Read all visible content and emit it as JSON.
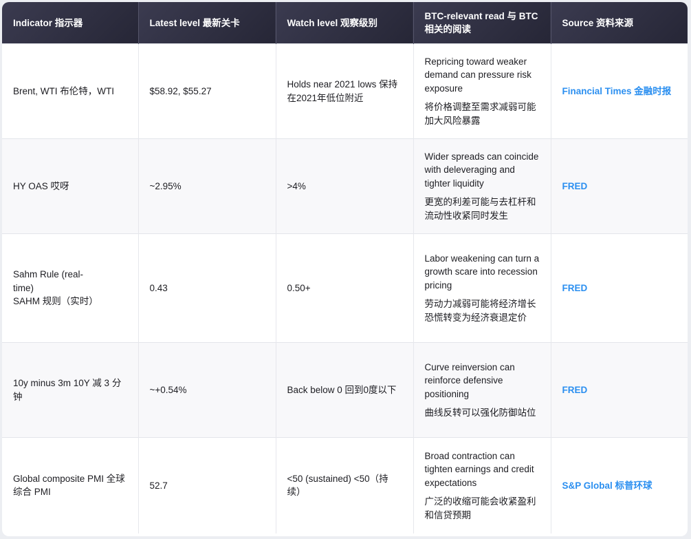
{
  "headers": [
    "Indicator  指示器",
    "Latest level  最新关卡",
    "Watch level  观察级别",
    "BTC-relevant read  与 BTC 相关的阅读",
    "Source  资料来源"
  ],
  "rows": [
    {
      "indicator": "Brent, WTI  布伦特，WTI",
      "latest": "$58.92, $55.27",
      "watch": "Holds near 2021 lows  保持在2021年低位附近",
      "read_en": "Repricing toward weaker demand can pressure risk exposure",
      "read_zh": "将价格调整至需求减弱可能加大风险暴露",
      "source": "Financial Times  金融时报"
    },
    {
      "indicator": "HY OAS  哎呀",
      "latest": "~2.95%",
      "watch": ">4%",
      "read_en": "Wider spreads can coincide with deleveraging and tighter liquidity",
      "read_zh": "更宽的利差可能与去杠杆和流动性收紧同时发生",
      "source": "FRED"
    },
    {
      "indicator": "Sahm Rule (real-time)",
      "indicator_zh": "SAHM 规则（实时）",
      "latest": "0.43",
      "watch": "0.50+",
      "read_en": "Labor weakening can turn a growth scare into recession pricing",
      "read_zh": "劳动力减弱可能将经济增长恐慌转变为经济衰退定价",
      "source": "FRED"
    },
    {
      "indicator": "10y minus 3m  10Y 减 3 分钟",
      "latest": "~+0.54%",
      "watch": "Back below 0  回到0度以下",
      "read_en": "Curve reinversion can reinforce defensive positioning",
      "read_zh": "曲线反转可以强化防御站位",
      "source": "FRED"
    },
    {
      "indicator": "Global composite PMI  全球综合 PMI",
      "latest": "52.7",
      "watch": "<50 (sustained)  <50（持续）",
      "read_en": "Broad contraction can tighten earnings and credit expectations",
      "read_zh": "广泛的收缩可能会收紧盈利和信贷预期",
      "source": "S&P Global  标普环球"
    }
  ]
}
